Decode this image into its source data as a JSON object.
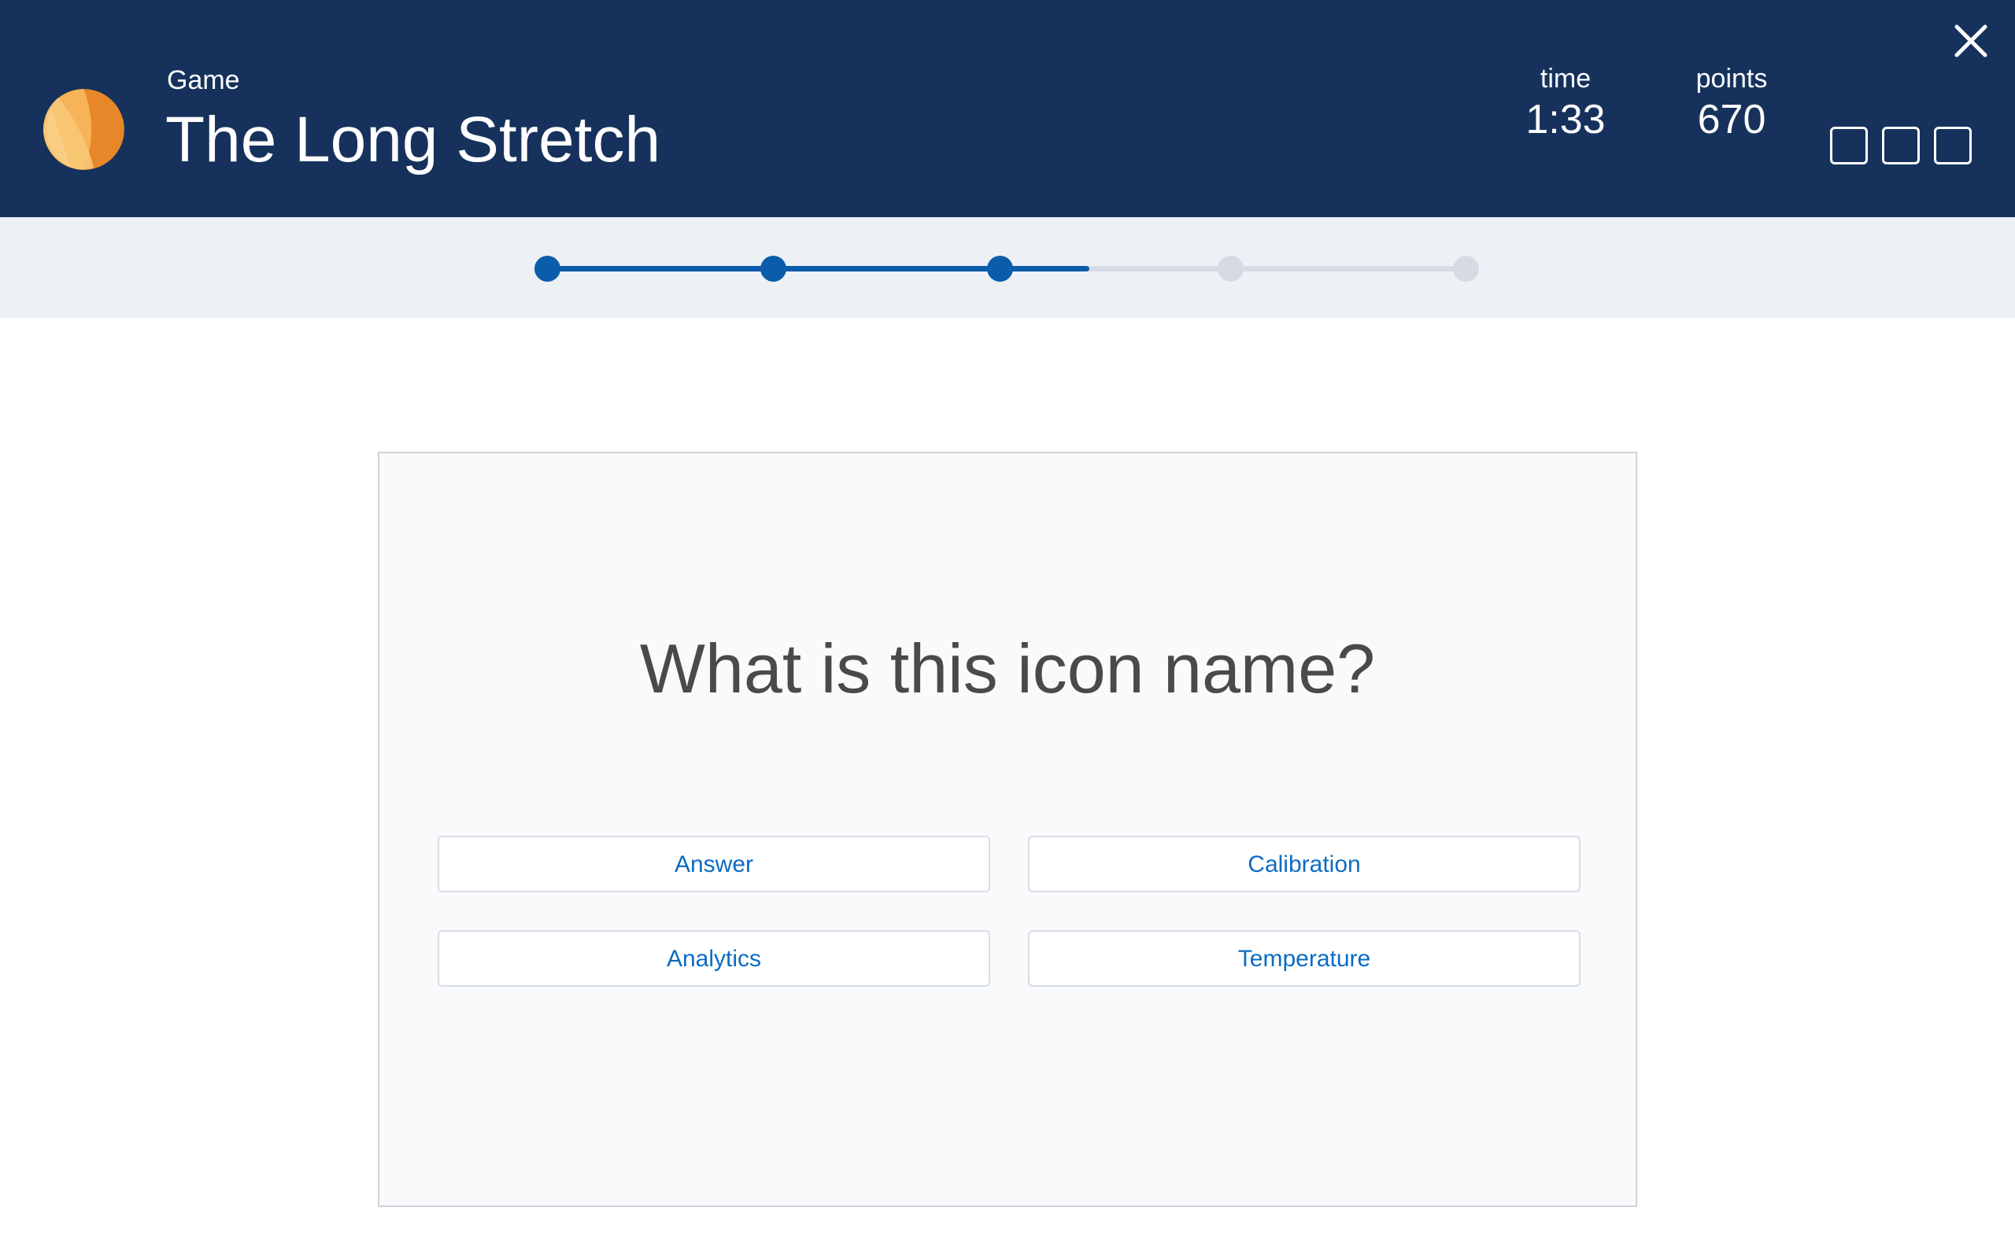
{
  "header": {
    "subtitle": "Game",
    "title": "The Long Stretch",
    "logo_icon": "orange-ball-icon",
    "close_icon": "close-icon",
    "stats": {
      "time_label": "time",
      "time_value": "1:33",
      "points_label": "points",
      "points_value": "670"
    },
    "slot_count": 3
  },
  "progress": {
    "total_steps": 5,
    "completed_steps": 3,
    "fill_fraction": 0.59
  },
  "question": {
    "text": "What is this icon name?",
    "answers": [
      "Answer",
      "Calibration",
      "Analytics",
      "Temperature"
    ]
  },
  "colors": {
    "header_bg": "#16325c",
    "progress_active": "#0b5cab",
    "progress_inactive": "#d6dbe3",
    "answer_text": "#0b6cc4",
    "logo_orange": "#f0a139"
  }
}
